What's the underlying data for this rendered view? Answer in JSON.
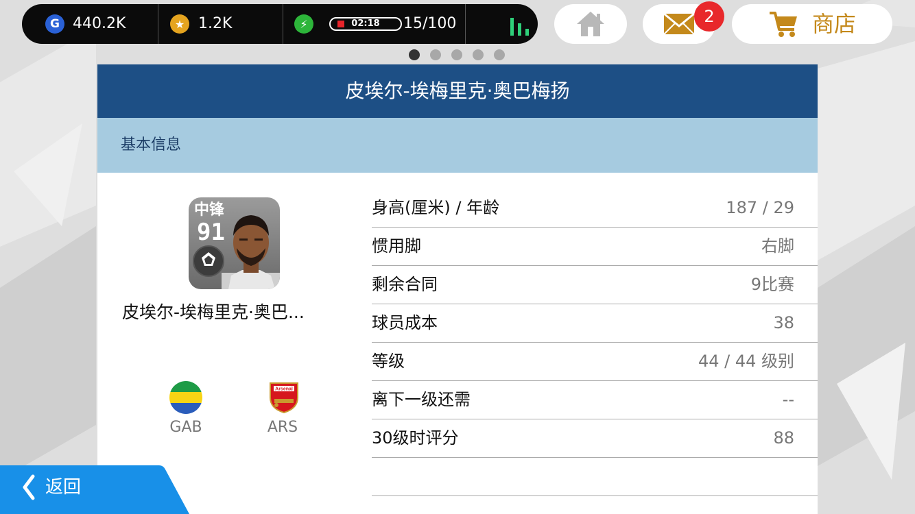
{
  "status_bar": {
    "gp_amount": "440.2K",
    "coins_amount": "1.2K",
    "stamina_timer": "02:18",
    "stamina_count": "15/100",
    "stamina_level": 0.15
  },
  "nav": {
    "mail_badge": "2",
    "shop_label": "商店"
  },
  "pager": {
    "pages": 5,
    "active": 1
  },
  "panel": {
    "title": "皮埃尔-埃梅里克·奥巴梅扬",
    "section_title": "基本信息"
  },
  "player": {
    "position": "中锋",
    "rating": "91",
    "name_short": "皮埃尔-埃梅里克·奥巴..."
  },
  "nationality": {
    "code": "GAB"
  },
  "club": {
    "code": "ARS",
    "crest_text": "Arsenal"
  },
  "stats": [
    {
      "label": "身高(厘米) / 年龄",
      "value": "187 / 29"
    },
    {
      "label": "惯用脚",
      "value": "右脚"
    },
    {
      "label": "剩余合同",
      "value": "9比赛"
    },
    {
      "label": "球员成本",
      "value": "38"
    },
    {
      "label": "等级",
      "value": "44 / 44 级别"
    },
    {
      "label": "离下一级还需",
      "value": "--"
    },
    {
      "label": "30级时评分",
      "value": "88"
    },
    {
      "label": "",
      "value": ""
    }
  ],
  "back_label": "返回",
  "colors": {
    "header": "#1d4f85",
    "section": "#a6cbe0",
    "back_button": "#1890e8",
    "shop_accent": "#c4891b",
    "badge": "#e8282b"
  }
}
